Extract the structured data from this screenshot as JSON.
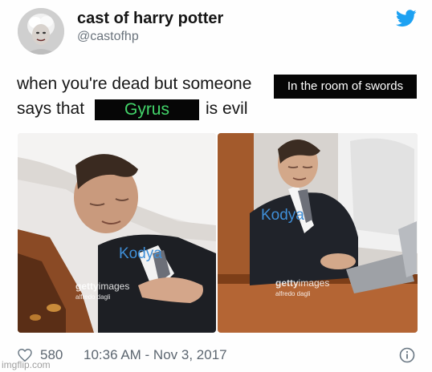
{
  "tweet": {
    "author_name": "cast of harry potter",
    "author_handle": "@castofhp",
    "text_line1": "when you're dead but someone",
    "redaction1": "In the room of swords",
    "text_line2_prefix": "says that",
    "redaction2": "Gyrus",
    "text_line2_suffix": "is evil"
  },
  "images": {
    "left_caption": "Kodya",
    "right_caption": "Kodya",
    "watermark_brand": "getty",
    "watermark_suffix": "images",
    "watermark_credit": "alfredo dagli"
  },
  "footer": {
    "likes": "580",
    "timestamp": "10:36 AM - Nov 3, 2017"
  },
  "site_watermark": "imgflip.com",
  "colors": {
    "twitter_blue": "#1da1f2",
    "redaction_text_green": "#43d56a",
    "caption_blue": "#3f8fd8"
  },
  "icons": {
    "platform": "twitter-bird-icon",
    "likes": "heart-icon",
    "info": "info-icon"
  }
}
